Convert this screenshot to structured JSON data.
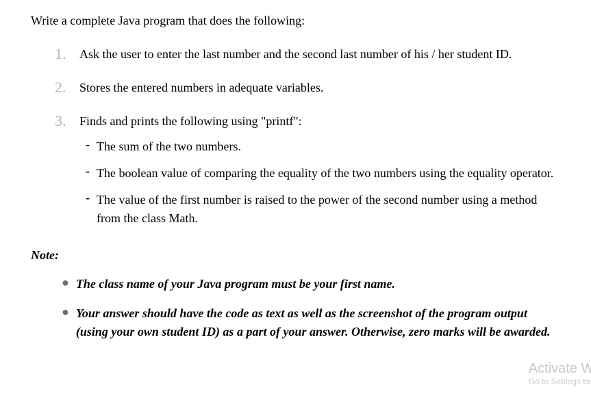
{
  "intro": "Write a complete Java program that does the following:",
  "ordered": [
    {
      "num": "1.",
      "text": "Ask the user to enter the last number and the second last number of his / her student ID."
    },
    {
      "num": "2.",
      "text": "Stores the entered numbers in adequate variables."
    },
    {
      "num": "3.",
      "text": "Finds and prints the following using \"printf\":"
    }
  ],
  "sub": [
    "The sum of the two numbers.",
    "The boolean value of comparing the equality of the two numbers using the equality operator.",
    "The value of the first number is raised to the power of the second number using a method from the class Math."
  ],
  "note_label": "Note:",
  "bullets": [
    "The class name of your Java program must be your first name.",
    "Your answer should have the code as text as well as the screenshot of the program output (using your own student ID) as a part of your answer. Otherwise, zero marks will be awarded."
  ],
  "watermark": {
    "title": "Activate Win",
    "sub": "Go to Settings to"
  }
}
